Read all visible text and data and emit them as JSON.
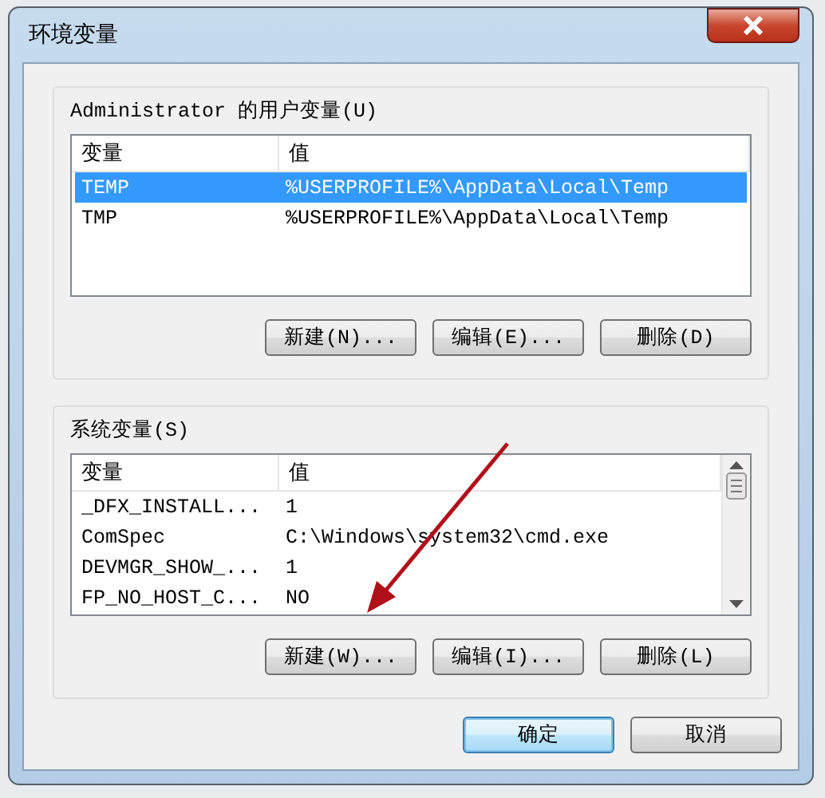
{
  "window": {
    "title": "环境变量"
  },
  "user_variables": {
    "label": "Administrator 的用户变量(U)",
    "columns": [
      "变量",
      "值"
    ],
    "rows": [
      {
        "name": "TEMP",
        "value": "%USERPROFILE%\\AppData\\Local\\Temp",
        "selected": true
      },
      {
        "name": "TMP",
        "value": "%USERPROFILE%\\AppData\\Local\\Temp",
        "selected": false
      }
    ],
    "buttons": [
      "新建(N)...",
      "编辑(E)...",
      "删除(D)"
    ]
  },
  "system_variables": {
    "label": "系统变量(S)",
    "columns": [
      "变量",
      "值"
    ],
    "rows": [
      {
        "name": "_DFX_INSTALL...",
        "value": "1",
        "selected": false
      },
      {
        "name": "ComSpec",
        "value": "C:\\Windows\\system32\\cmd.exe",
        "selected": false
      },
      {
        "name": "DEVMGR_SHOW_...",
        "value": "1",
        "selected": false
      },
      {
        "name": "FP_NO_HOST_C...",
        "value": "NO",
        "selected": false
      }
    ],
    "buttons": [
      "新建(W)...",
      "编辑(I)...",
      "删除(L)"
    ]
  },
  "dialog_buttons": [
    {
      "label": "确定",
      "kind": "default"
    },
    {
      "label": "取消",
      "kind": "normal"
    }
  ]
}
